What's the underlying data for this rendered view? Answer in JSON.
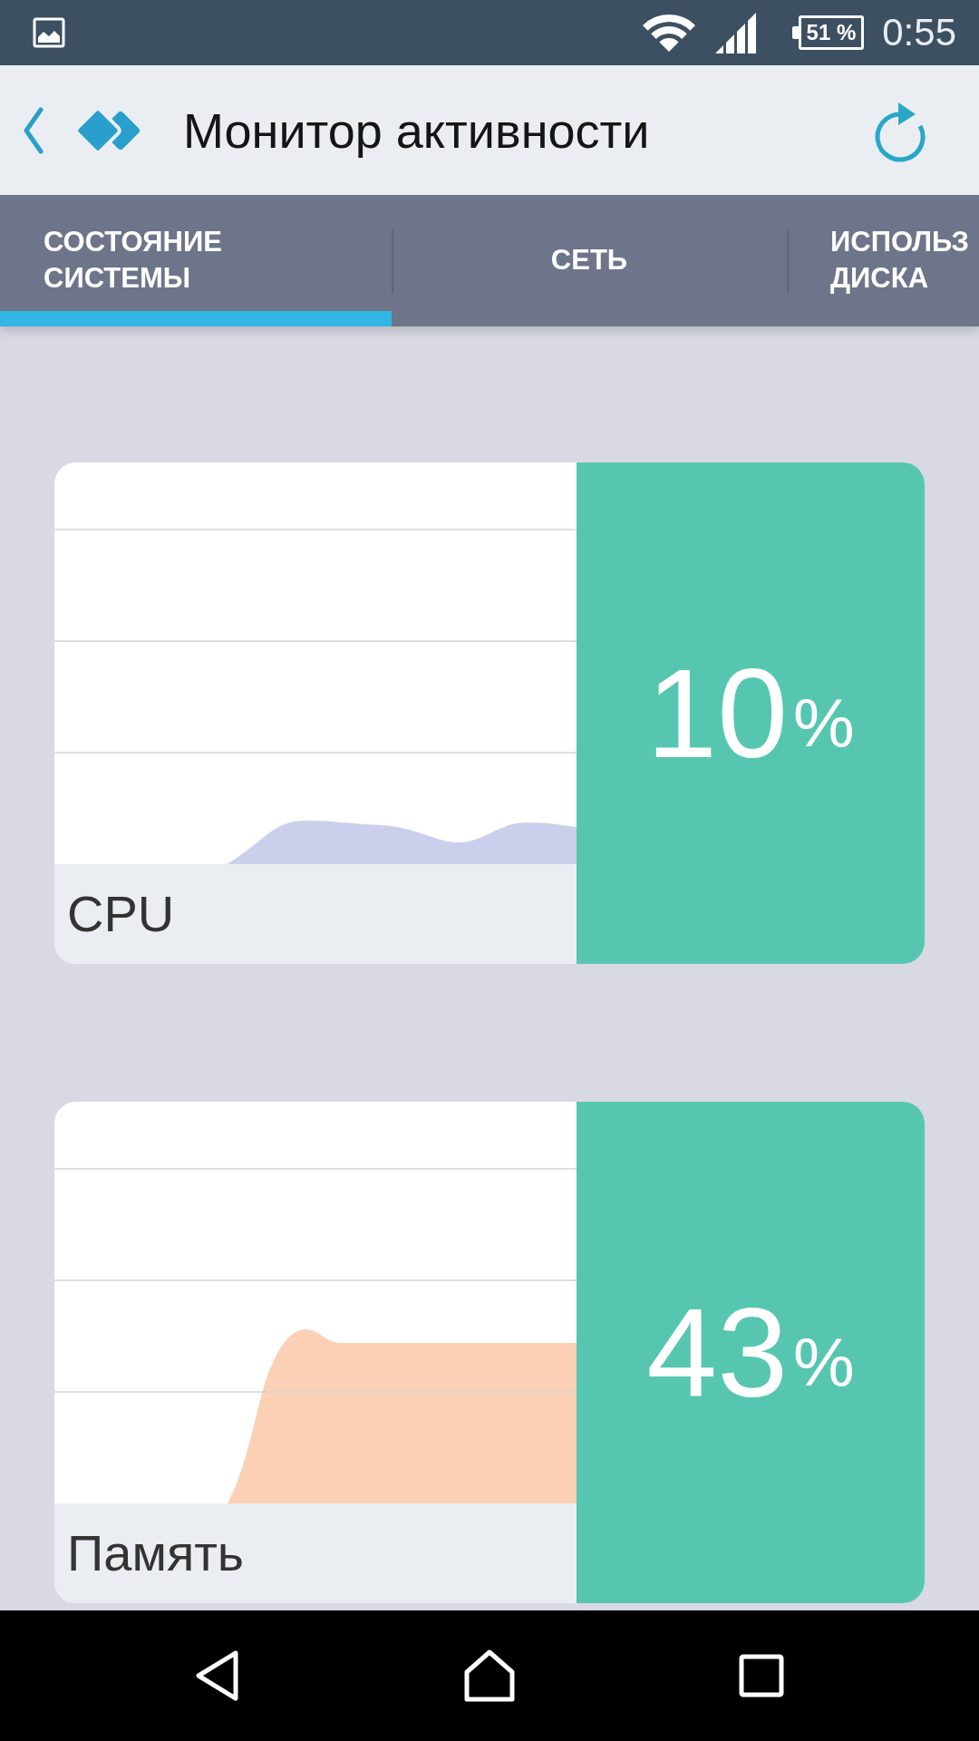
{
  "status_bar": {
    "battery": "51 %",
    "time": "0:55"
  },
  "app_bar": {
    "title": "Монитор активности"
  },
  "tabs": [
    {
      "label": "СОСТОЯНИЕ СИСТЕМЫ",
      "selected": true
    },
    {
      "label": "СЕТЬ",
      "selected": false
    },
    {
      "label": "ИСПОЛЬЗ ДИСКА",
      "selected": false
    }
  ],
  "monitors": [
    {
      "label": "CPU",
      "value": "10",
      "unit": "%",
      "color": "#cccfec"
    },
    {
      "label": "Память",
      "value": "43",
      "unit": "%",
      "color": "#fcd0b4"
    }
  ]
}
